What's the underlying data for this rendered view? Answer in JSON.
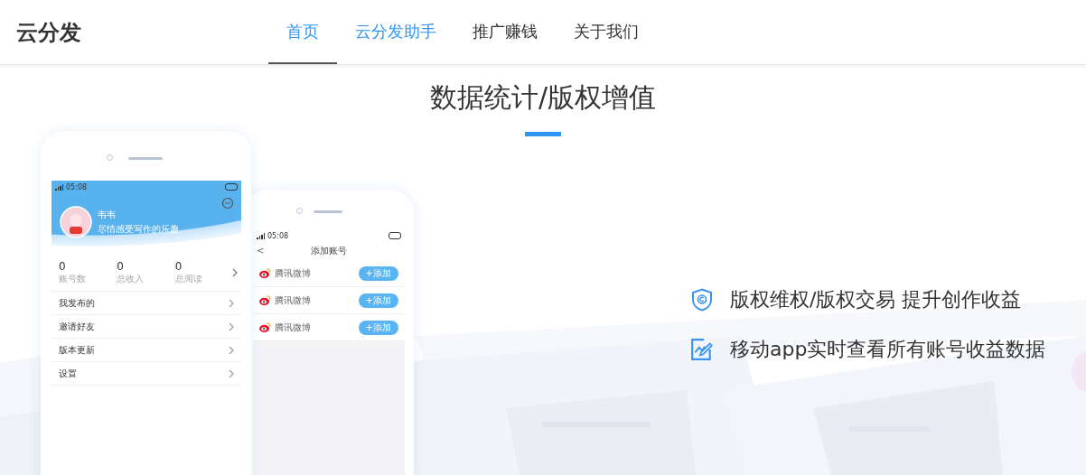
{
  "header": {
    "logo": "云分发",
    "nav": [
      {
        "label": "首页",
        "selected": true,
        "highlighted": true
      },
      {
        "label": "云分发助手",
        "selected": false,
        "highlighted": true
      },
      {
        "label": "推广赚钱",
        "selected": false,
        "highlighted": false
      },
      {
        "label": "关于我们",
        "selected": false,
        "highlighted": false
      }
    ]
  },
  "section": {
    "title": "数据统计/版权增值"
  },
  "phone_profile": {
    "time": "05:08",
    "user_name": "韦韦",
    "motto": "尽情感受写作的乐趣",
    "stats": [
      {
        "value": "0",
        "label": "账号数"
      },
      {
        "value": "0",
        "label": "总收入"
      },
      {
        "value": "0",
        "label": "总阅读"
      }
    ],
    "menu": [
      "我发布的",
      "邀请好友",
      "版本更新",
      "设置"
    ]
  },
  "phone_accounts": {
    "time": "05:08",
    "title": "添加账号",
    "back": "<",
    "accounts": [
      {
        "name": "腾讯微博",
        "action": "+添加"
      },
      {
        "name": "腾讯微博",
        "action": "+添加"
      },
      {
        "name": "腾讯微博",
        "action": "+添加"
      }
    ]
  },
  "features": [
    {
      "kind": "shield",
      "text": "版权维权/版权交易 提升创作收益"
    },
    {
      "kind": "chart",
      "text": "移动app实时查看所有账号收益数据"
    }
  ]
}
